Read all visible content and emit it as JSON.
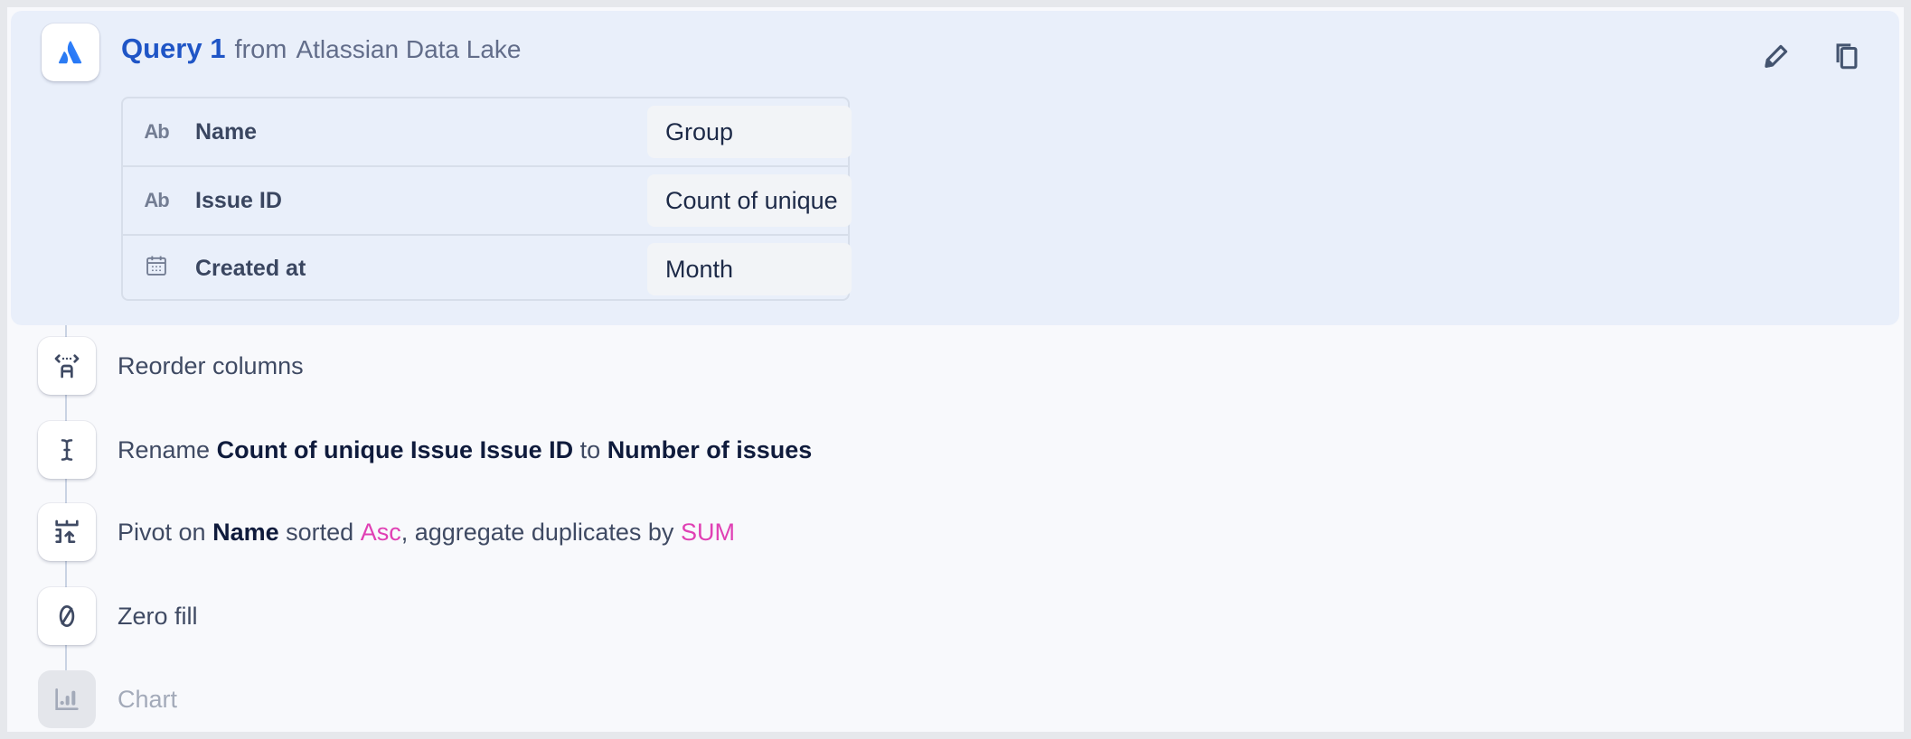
{
  "query": {
    "name": "Query 1",
    "from_label": "from",
    "source": "Atlassian Data Lake",
    "source_icon": "atlassian-logo-icon",
    "actions": [
      {
        "name": "edit",
        "icon": "pencil-icon"
      },
      {
        "name": "duplicate",
        "icon": "copy-icon"
      }
    ],
    "fields": [
      {
        "type_icon": "text-type-icon",
        "type_label": "Ab",
        "name": "Name",
        "value": "Group"
      },
      {
        "type_icon": "text-type-icon",
        "type_label": "Ab",
        "name": "Issue ID",
        "value": "Count of unique"
      },
      {
        "type_icon": "calendar-icon",
        "type_label": "",
        "name": "Created at",
        "value": "Month"
      }
    ]
  },
  "steps": [
    {
      "icon": "reorder-columns-icon",
      "label": "Reorder columns"
    },
    {
      "icon": "rename-cursor-icon",
      "prefix": "Rename",
      "from_column": "Count of unique Issue Issue ID",
      "connector": "to",
      "to_column": "Number of issues"
    },
    {
      "icon": "pivot-icon",
      "prefix": "Pivot on",
      "column": "Name",
      "sorted_label": "sorted",
      "sort_order": "Asc",
      "aggregate_label": ", aggregate duplicates by",
      "aggregate_fn": "SUM"
    },
    {
      "icon": "zero-fill-icon",
      "label": "Zero fill"
    },
    {
      "icon": "chart-icon",
      "label": "Chart",
      "disabled": true
    }
  ],
  "colors": {
    "accent_blue": "#1f55c6",
    "accent_pink": "#e040b4",
    "panel_bg": "#e9effa"
  }
}
